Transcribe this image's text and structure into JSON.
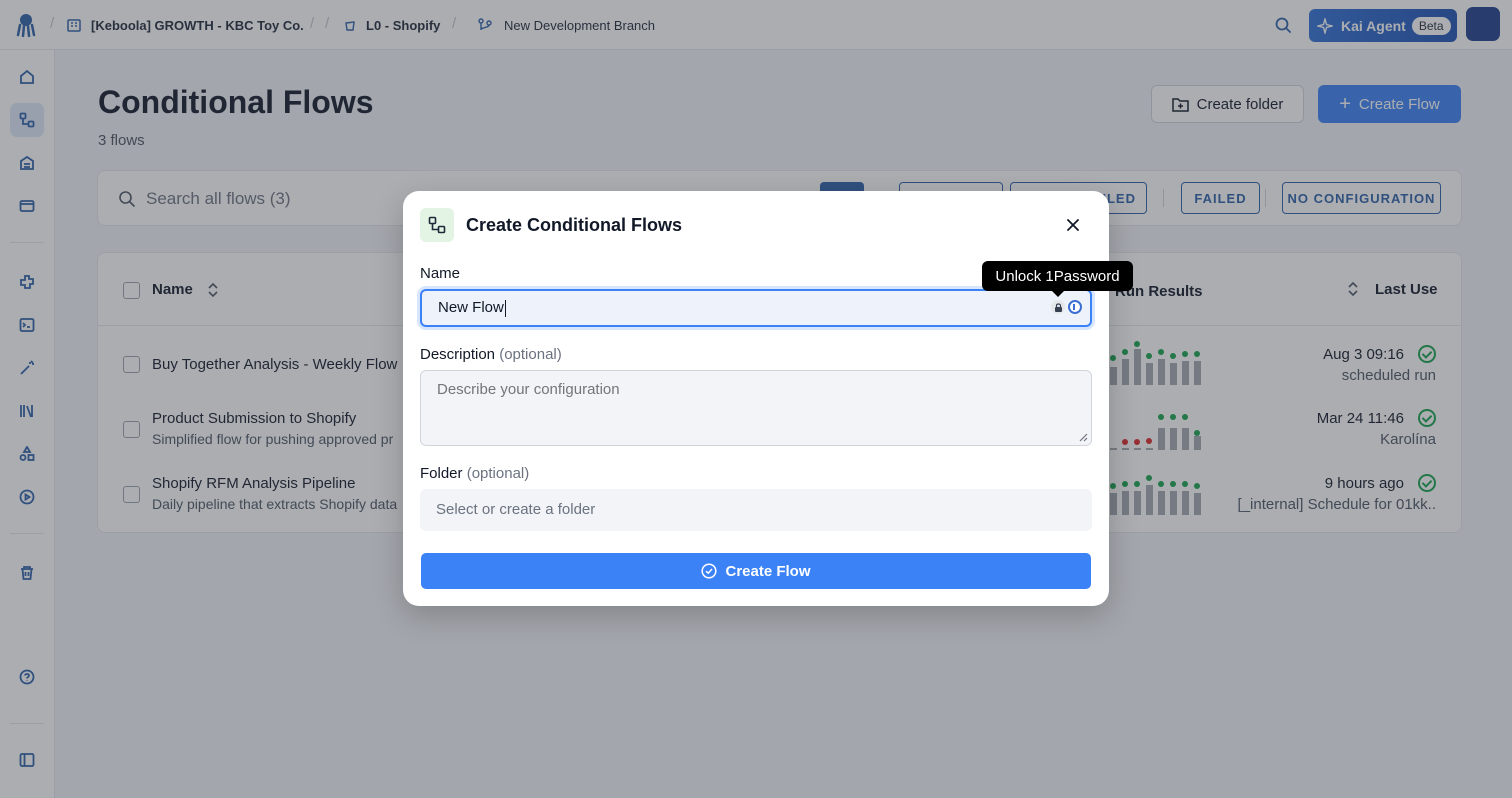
{
  "topbar": {
    "project": "[Keboola] GROWTH - KBC Toy Co.",
    "component": "L0 - Shopify",
    "branch": "New Development Branch",
    "kai_label": "Kai Agent",
    "kai_badge": "Beta"
  },
  "page": {
    "title": "Conditional Flows",
    "subtitle": "3 flows",
    "create_folder_label": "Create folder",
    "create_flow_label": "Create Flow"
  },
  "search": {
    "placeholder": "Search all flows (3)",
    "filters": [
      "SCHEDULED",
      "FAILED",
      "NO CONFIGURATION"
    ]
  },
  "table": {
    "headers": {
      "name": "Name",
      "run_results": "Run Results",
      "last_use": "Last Use"
    },
    "rows": [
      {
        "name": "Buy Together Analysis - Weekly Flow",
        "description": "",
        "date": "Aug 3 09:16",
        "user": "scheduled run"
      },
      {
        "name": "Product Submission to Shopify",
        "description": "Simplified flow for pushing approved pr",
        "date": "Mar 24 11:46",
        "user": "Karolína"
      },
      {
        "name": "Shopify RFM Analysis Pipeline",
        "description": "Daily pipeline that extracts Shopify data",
        "date": "9 hours ago",
        "user": "[_internal] Schedule for 01kk.."
      }
    ]
  },
  "modal": {
    "title": "Create Conditional Flows",
    "name_label": "Name",
    "name_value": "New Flow",
    "description_label": "Description",
    "description_optional": "(optional)",
    "description_placeholder": "Describe your configuration",
    "folder_label": "Folder",
    "folder_optional": "(optional)",
    "folder_placeholder": "Select or create a folder",
    "submit_label": "Create Flow"
  },
  "tooltip": {
    "text": "Unlock 1Password"
  },
  "colors": {
    "accent": "#3b82f6",
    "brand_dark": "#2b5fa8",
    "success": "#16a34a",
    "failed": "#dc2626"
  }
}
